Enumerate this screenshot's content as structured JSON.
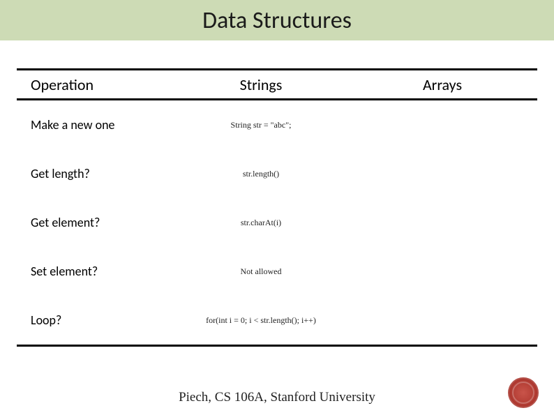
{
  "title": "Data Structures",
  "headers": {
    "operation": "Operation",
    "strings": "Strings",
    "arrays": "Arrays"
  },
  "rows": [
    {
      "operation": "Make a new one",
      "strings": "String str = \"abc\";"
    },
    {
      "operation": "Get length?",
      "strings": "str.length()"
    },
    {
      "operation": "Get element?",
      "strings": "str.charAt(i)"
    },
    {
      "operation": "Set element?",
      "strings": "Not allowed"
    },
    {
      "operation": "Loop?",
      "strings": "for(int i = 0; i < str.length(); i++)"
    }
  ],
  "footer": "Piech, CS 106A, Stanford University"
}
